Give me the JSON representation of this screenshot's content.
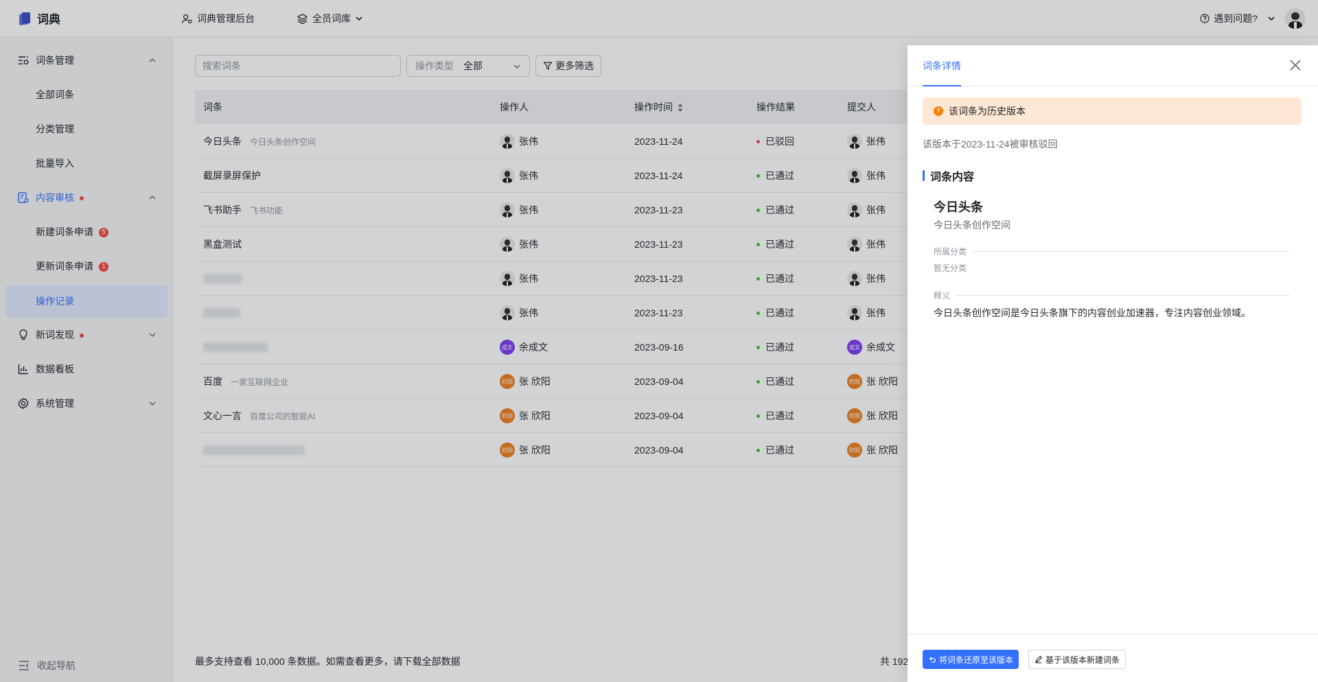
{
  "app": {
    "brand": "词典",
    "nav_admin": "词典管理后台",
    "nav_library": "全员词库",
    "help": "遇到问题?"
  },
  "sidebar": {
    "items": [
      {
        "label": "词条管理",
        "icon": "entry-manage-icon"
      },
      {
        "label": "全部词条"
      },
      {
        "label": "分类管理"
      },
      {
        "label": "批量导入"
      },
      {
        "label": "内容审核",
        "icon": "review-icon"
      },
      {
        "label": "新建词条申请",
        "badge": "5"
      },
      {
        "label": "更新词条申请",
        "badge": "1"
      },
      {
        "label": "操作记录"
      },
      {
        "label": "新词发现",
        "icon": "bulb-icon"
      },
      {
        "label": "数据看板",
        "icon": "chart-icon"
      },
      {
        "label": "系统管理",
        "icon": "settings-icon"
      }
    ],
    "collapse": "收起导航"
  },
  "filters": {
    "search_placeholder": "搜索词条",
    "op_type_label": "操作类型",
    "op_type_value": "全部",
    "more": "更多筛选"
  },
  "table": {
    "headers": [
      "词条",
      "操作人",
      "操作时间",
      "操作结果",
      "提交人"
    ],
    "rows": [
      {
        "term": "今日头条",
        "desc": "今日头条创作空间",
        "op": "张伟",
        "time": "2023-11-24",
        "result": "已驳回",
        "sub": "张伟"
      },
      {
        "term": "截屏录屏保护",
        "desc": "",
        "op": "张伟",
        "time": "2023-11-24",
        "result": "已通过",
        "sub": "张伟"
      },
      {
        "term": "飞书助手",
        "desc": "飞书功能",
        "op": "张伟",
        "time": "2023-11-23",
        "result": "已通过",
        "sub": "张伟"
      },
      {
        "term": "黑盒测试",
        "desc": "",
        "op": "张伟",
        "time": "2023-11-23",
        "result": "已通过",
        "sub": "张伟"
      },
      {
        "term": "",
        "desc": "",
        "op": "张伟",
        "time": "2023-11-23",
        "result": "已通过",
        "sub": "张伟"
      },
      {
        "term": "",
        "desc": "",
        "op": "张伟",
        "time": "2023-11-23",
        "result": "已通过",
        "sub": "张伟"
      },
      {
        "term": "",
        "desc": "",
        "op": "余成文",
        "op_avatar": "成文",
        "time": "2023-09-16",
        "result": "已通过",
        "sub": "余成文",
        "sub_avatar": "成文"
      },
      {
        "term": "百度",
        "desc": "一家互联网企业",
        "op": "张 欣阳",
        "op_avatar": "欣阳",
        "time": "2023-09-04",
        "result": "已通过",
        "sub": "张 欣阳",
        "sub_avatar": "欣阳"
      },
      {
        "term": "文心一言",
        "desc": "百度公司的智能AI",
        "op": "张 欣阳",
        "op_avatar": "欣阳",
        "time": "2023-09-04",
        "result": "已通过",
        "sub": "张 欣阳",
        "sub_avatar": "欣阳"
      },
      {
        "term": "",
        "desc": "",
        "op": "张 欣阳",
        "op_avatar": "欣阳",
        "time": "2023-09-04",
        "result": "已通过",
        "sub": "张 欣阳",
        "sub_avatar": "欣阳"
      }
    ],
    "footer_note": "最多支持查看 10,000 条数据。如需查看更多，请下载全部数据",
    "total": "共 192"
  },
  "drawer": {
    "tab": "词条详情",
    "alert": "该词条为历史版本",
    "version_note": "该版本于2023-11-24被审核驳回",
    "section": "词条内容",
    "entry_title": "今日头条",
    "entry_sub": "今日头条创作空间",
    "category_label": "所属分类",
    "category_value": "暂无分类",
    "meaning_label": "释义",
    "meaning_text": "今日头条创作空间是今日头条旗下的内容创业加速器，专注内容创业领域。",
    "btn_restore": "将词条还原至该版本",
    "btn_new": "基于该版本新建词条"
  },
  "colors": {
    "accent": "#3370ff",
    "reject": "#f54a45",
    "pass": "#34c724",
    "avatar_purple": "#7f3bf5",
    "avatar_orange": "#ed8020"
  }
}
